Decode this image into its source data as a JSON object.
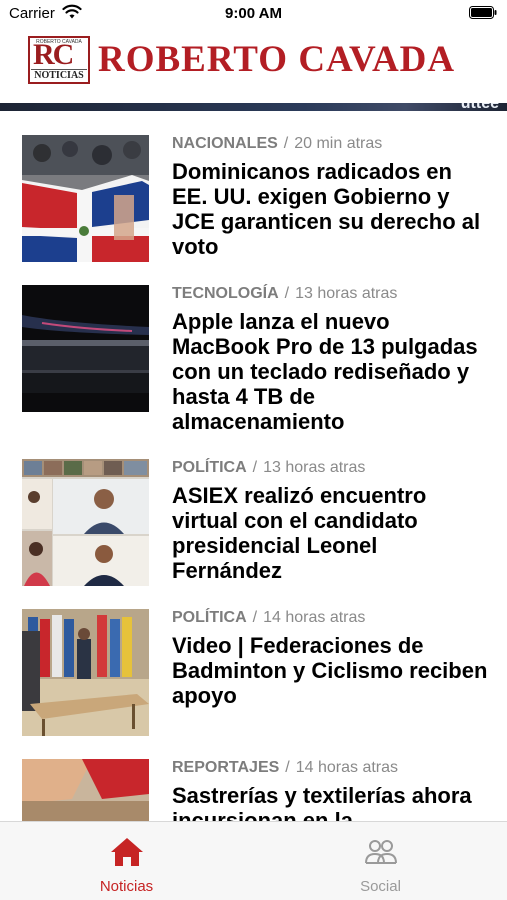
{
  "status_bar": {
    "carrier": "Carrier",
    "time": "9:00 AM"
  },
  "header": {
    "logo_tiny": "ROBERTO CAVADA",
    "logo_letters": "RC",
    "logo_sub": "NOTICIAS",
    "brand_name": "ROBERTO CAVADA",
    "banner_text": "uttee"
  },
  "feed": [
    {
      "category": "NACIONALES",
      "time": "20 min atras",
      "title": "Dominicanos radicados en EE. UU. exigen Gobierno y JCE garanticen su derecho al voto"
    },
    {
      "category": "TECNOLOGÍA",
      "time": "13 horas atras",
      "title": "Apple lanza el nuevo MacBook Pro de 13 pulgadas con un teclado rediseñado y hasta 4 TB de almacenamiento"
    },
    {
      "category": "POLÍTICA",
      "time": "13 horas atras",
      "title": "ASIEX realizó encuentro virtual con el candidato presidencial Leonel Fernández"
    },
    {
      "category": "POLÍTICA",
      "time": "14 horas atras",
      "title": "Video | Federaciones de Badminton y Ciclismo reciben apoyo"
    },
    {
      "category": "REPORTAJES",
      "time": "14 horas atras",
      "title": "Sastrerías y textilerías ahora incursionan en la"
    }
  ],
  "tabbar": {
    "tabs": [
      {
        "label": "Noticias",
        "icon": "home-icon",
        "active": true
      },
      {
        "label": "Social",
        "icon": "people-icon",
        "active": false
      }
    ],
    "active_color": "#c62424",
    "inactive_color": "#9a9a9a"
  },
  "colors": {
    "brand": "#b31e24"
  }
}
